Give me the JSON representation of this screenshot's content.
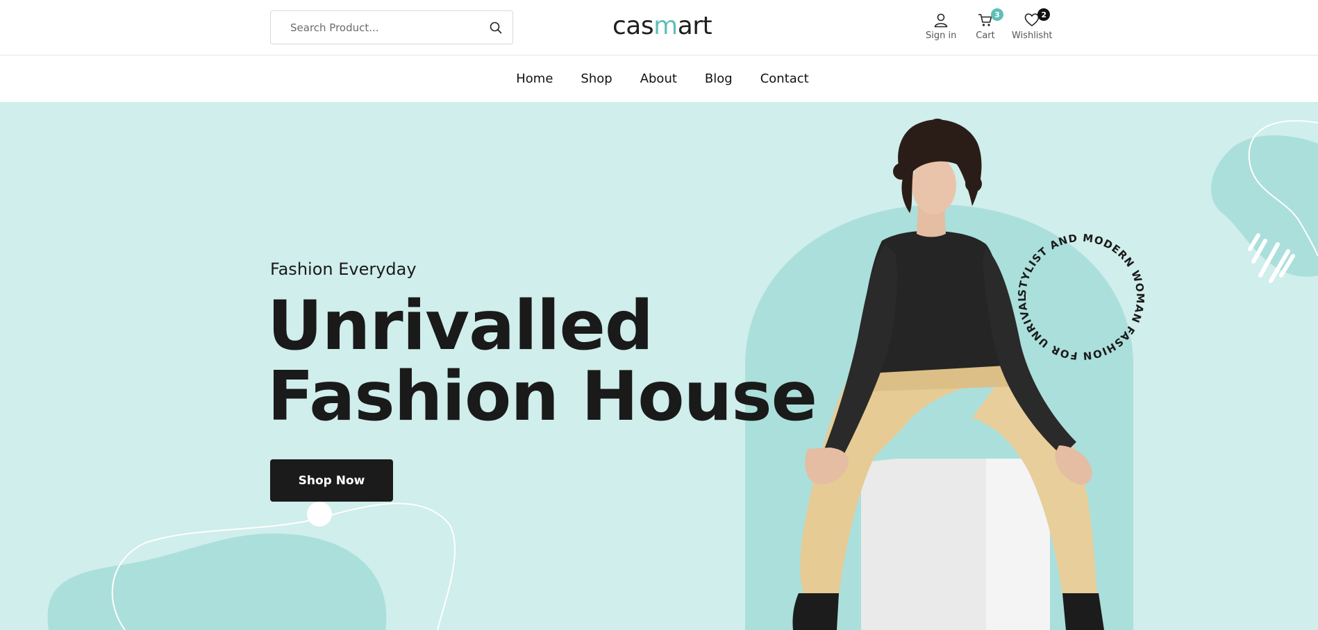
{
  "header": {
    "search_placeholder": "Search Product...",
    "logo_pre": "cas",
    "logo_accent": "m",
    "logo_post": "art",
    "signin_label": "Sign in",
    "cart_label": "Cart",
    "cart_count": "3",
    "wishlist_label": "Wishlisht",
    "wishlist_count": "2"
  },
  "nav": {
    "items": [
      "Home",
      "Shop",
      "About",
      "Blog",
      "Contact"
    ]
  },
  "hero": {
    "eyebrow": "Fashion Everyday",
    "headline_line1": "Unrivalled",
    "headline_line2": "Fashion House",
    "cta_label": "Shop Now",
    "circular_text": "STYLIST AND MODERN WOMAN FASHION FOR UNRIVALLED WOMAN"
  },
  "colors": {
    "hero_bg": "#d0eeeb",
    "hero_shape": "#abdfdb",
    "accent": "#5fbfb7",
    "dark": "#1b1b1b"
  },
  "icons": [
    "search-icon",
    "user-icon",
    "cart-icon",
    "heart-icon"
  ]
}
